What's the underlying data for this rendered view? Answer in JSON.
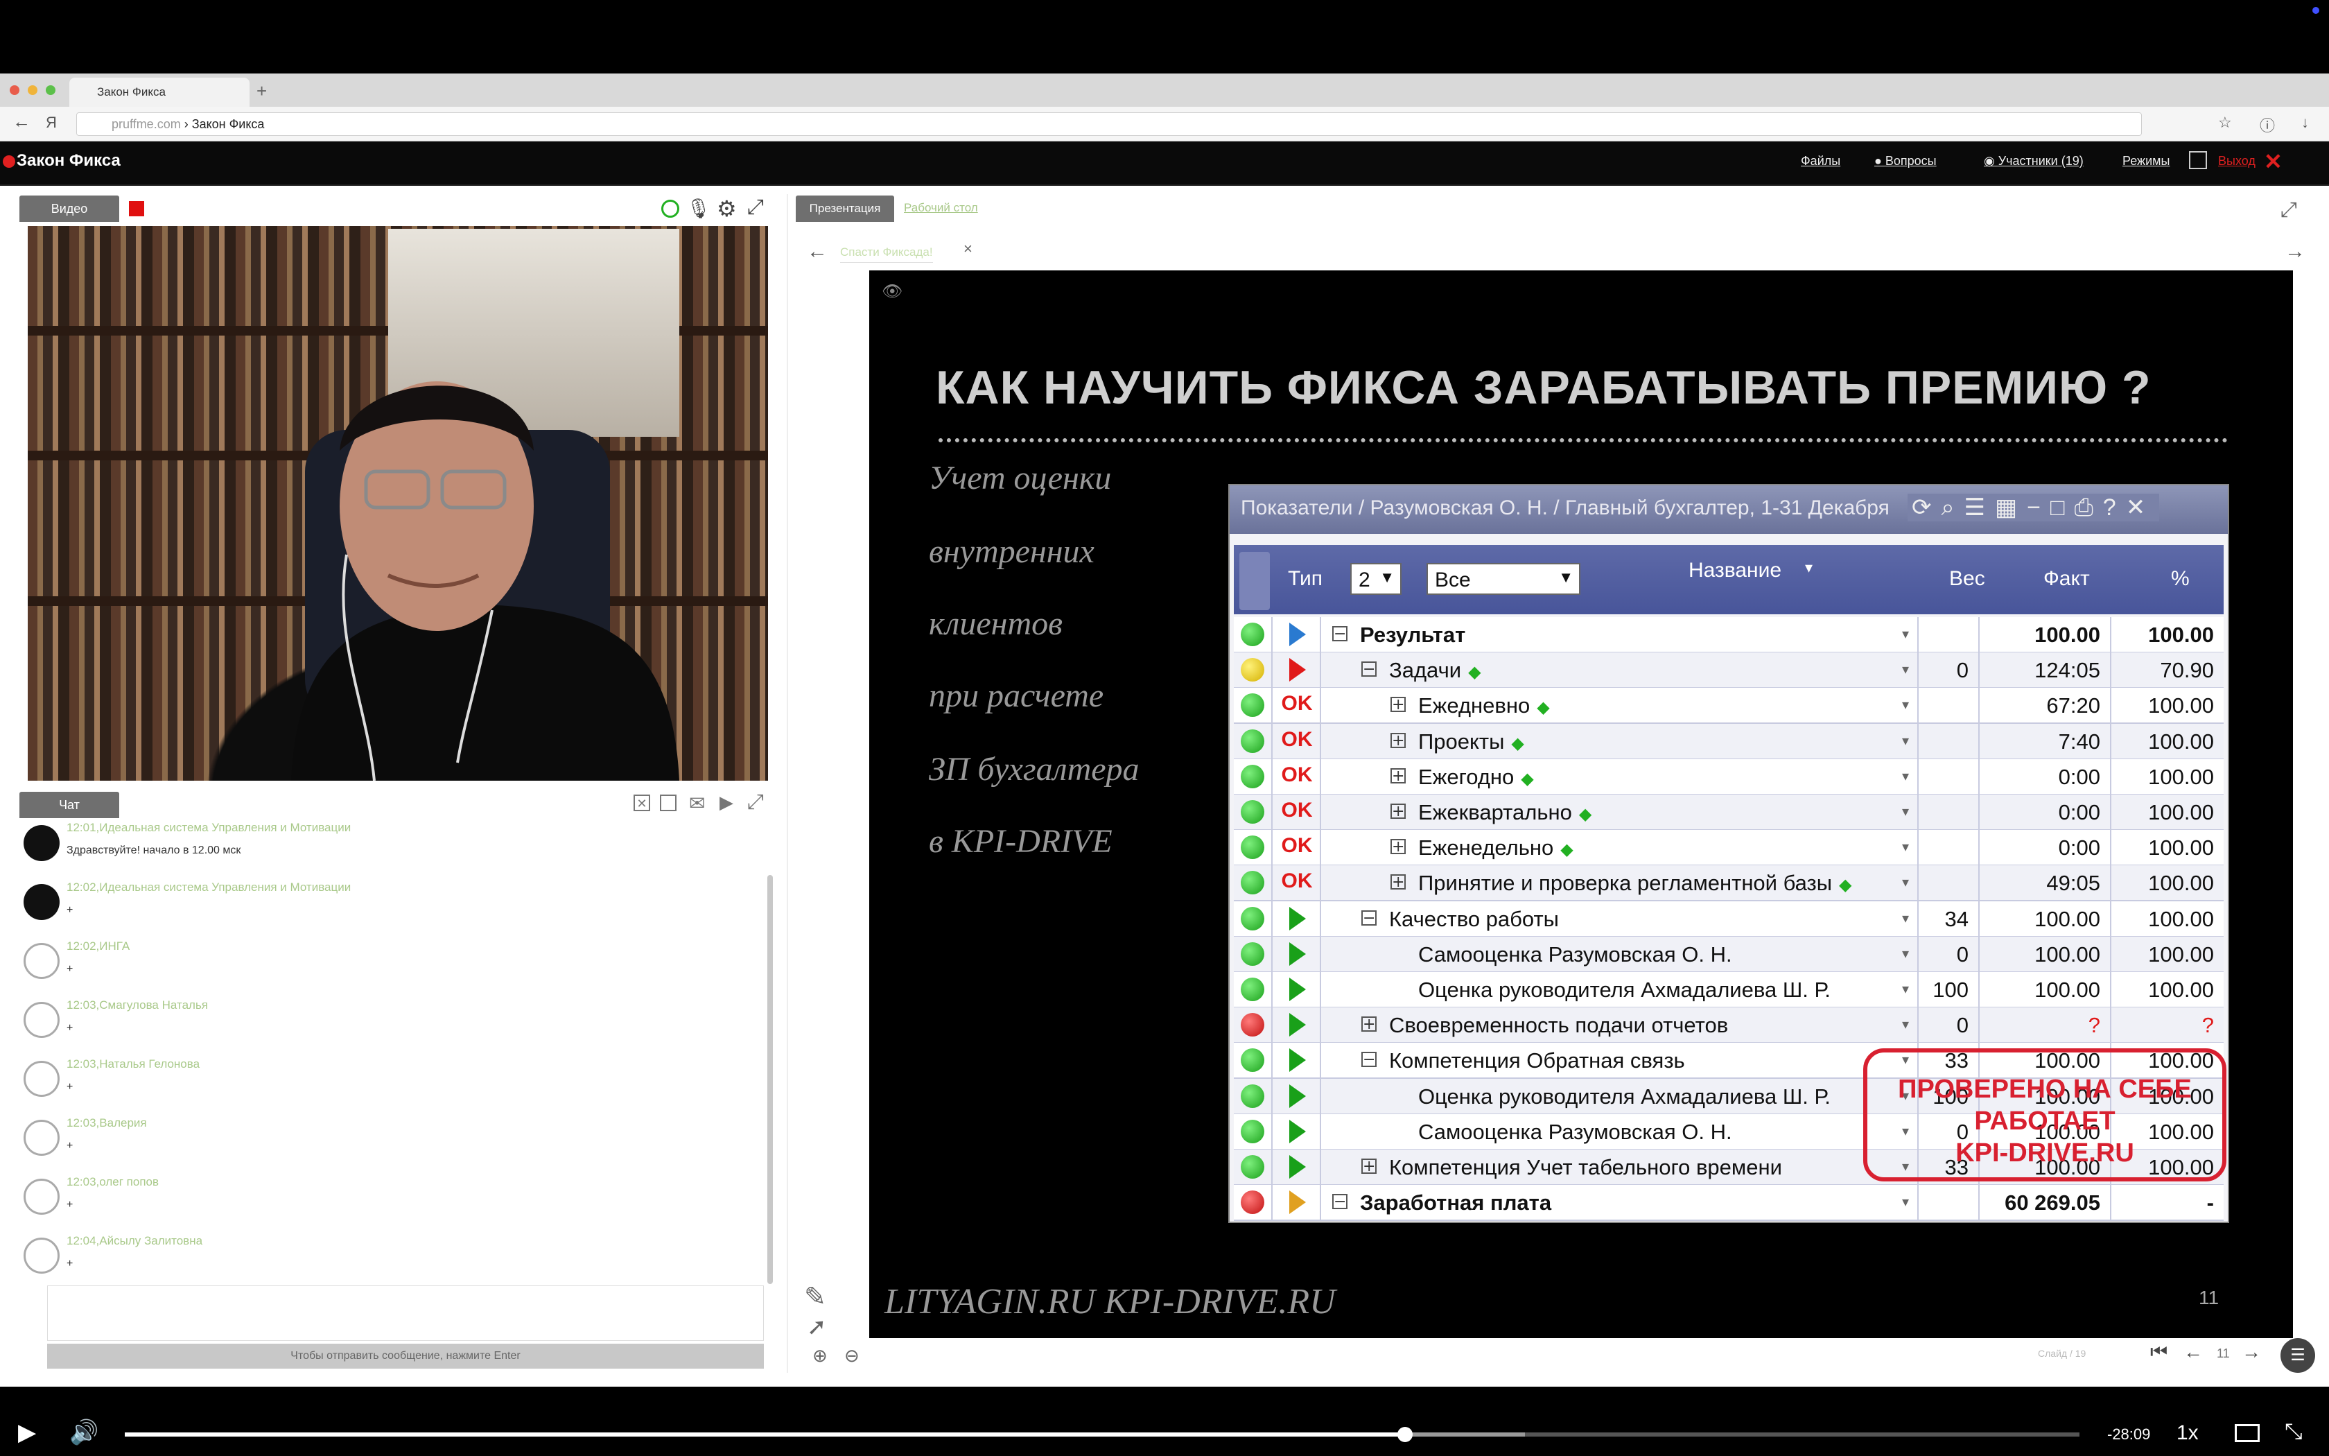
{
  "browser": {
    "tab_title": "Закон Фикса",
    "url_host": "pruffme.com",
    "url_sep": " › ",
    "url_path": "Закон Фикса"
  },
  "app": {
    "name": "Закон Фикса",
    "nav": {
      "files": "Файлы",
      "questions": "Вопросы",
      "participants": "Участники (19)",
      "modes": "Режимы",
      "exit": "Выход"
    }
  },
  "video_panel": {
    "tab": "Видео"
  },
  "chat": {
    "tab": "Чат",
    "messages": [
      {
        "time": "12:01",
        "author": "Идеальная система Управления и Мотивации",
        "text": "Здравствуйте! начало в 12.00 мск"
      },
      {
        "time": "12:02",
        "author": "Идеальная система Управления и Мотивации",
        "text": "+"
      },
      {
        "time": "12:02",
        "author": "ИНГА",
        "text": "+"
      },
      {
        "time": "12:03",
        "author": "Смагулова Наталья",
        "text": "+"
      },
      {
        "time": "12:03",
        "author": "Наталья Гелонова",
        "text": "+"
      },
      {
        "time": "12:03",
        "author": "Валерия",
        "text": "+"
      },
      {
        "time": "12:03",
        "author": "олег попов",
        "text": "+"
      },
      {
        "time": "12:04",
        "author": "Айсылу Залитовна",
        "text": "+"
      }
    ],
    "hint": "Чтобы отправить сообщение, нажмите Enter"
  },
  "presentation": {
    "tabs": [
      "Презентация",
      "Рабочий стол"
    ],
    "file_tab": "Спасти Фиксада!",
    "slide": {
      "title": "КАК НАУЧИТЬ ФИКСА ЗАРАБАТЫВАТЬ ПРЕМИЮ ?",
      "left_text": [
        "Учет оценки",
        "внутренних",
        "клиентов",
        "при расчете",
        "ЗП бухгалтера",
        "в KPI-DRIVE"
      ],
      "footer": "LITYAGIN.RU  KPI-DRIVE.RU",
      "number": "11",
      "stamp": [
        "ПРОВЕРЕНО НА СЕБЕ",
        "РАБОТАЕТ",
        "KPI-DRIVE.RU"
      ],
      "kpi_window": {
        "title": "Показатели / Разумовская О. Н. / Главный бухгалтер, 1-31 Декабря",
        "headers": {
          "type": "Тип",
          "level": "2",
          "filter": "Все",
          "name": "Название",
          "weight": "Вес",
          "fact": "Факт",
          "pct": "%"
        },
        "rows": [
          {
            "status": "g",
            "type": "flag-blue",
            "expand": "−",
            "indent": 0,
            "name": "Результат",
            "bold": true,
            "diamond": false,
            "weight": "",
            "fact": "100.00",
            "pct": "100.00"
          },
          {
            "status": "y",
            "type": "flag-red",
            "expand": "−",
            "indent": 1,
            "name": "Задачи",
            "bold": false,
            "diamond": true,
            "weight": "0",
            "fact": "124:05",
            "pct": "70.90"
          },
          {
            "status": "g",
            "type": "OK",
            "expand": "+",
            "indent": 2,
            "name": "Ежедневно",
            "bold": false,
            "diamond": true,
            "weight": "",
            "fact": "67:20",
            "pct": "100.00"
          },
          {
            "status": "g",
            "type": "OK",
            "expand": "+",
            "indent": 2,
            "name": "Проекты",
            "bold": false,
            "diamond": true,
            "weight": "",
            "fact": "7:40",
            "pct": "100.00"
          },
          {
            "status": "g",
            "type": "OK",
            "expand": "+",
            "indent": 2,
            "name": "Ежегодно",
            "bold": false,
            "diamond": true,
            "weight": "",
            "fact": "0:00",
            "pct": "100.00"
          },
          {
            "status": "g",
            "type": "OK",
            "expand": "+",
            "indent": 2,
            "name": "Ежеквартально",
            "bold": false,
            "diamond": true,
            "weight": "",
            "fact": "0:00",
            "pct": "100.00"
          },
          {
            "status": "g",
            "type": "OK",
            "expand": "+",
            "indent": 2,
            "name": "Еженедельно",
            "bold": false,
            "diamond": true,
            "weight": "",
            "fact": "0:00",
            "pct": "100.00"
          },
          {
            "status": "g",
            "type": "OK",
            "expand": "+",
            "indent": 2,
            "name": "Принятие и проверка регламентной базы",
            "bold": false,
            "diamond": true,
            "weight": "",
            "fact": "49:05",
            "pct": "100.00"
          },
          {
            "status": "g",
            "type": "flag-green",
            "expand": "−",
            "indent": 1,
            "name": "Качество работы",
            "bold": false,
            "diamond": false,
            "weight": "34",
            "fact": "100.00",
            "pct": "100.00"
          },
          {
            "status": "g",
            "type": "flag-green",
            "expand": "",
            "indent": 2,
            "name": "Самооценка Разумовская О. Н.",
            "bold": false,
            "diamond": false,
            "weight": "0",
            "fact": "100.00",
            "pct": "100.00"
          },
          {
            "status": "g",
            "type": "flag-green",
            "expand": "",
            "indent": 2,
            "name": "Оценка руководителя Ахмадалиева Ш. Р.",
            "bold": false,
            "diamond": false,
            "weight": "100",
            "fact": "100.00",
            "pct": "100.00"
          },
          {
            "status": "r",
            "type": "flag-green",
            "expand": "+",
            "indent": 1,
            "name": "Своевременность подачи отчетов",
            "bold": false,
            "diamond": false,
            "weight": "0",
            "fact": "?",
            "pct": "?"
          },
          {
            "status": "g",
            "type": "flag-green",
            "expand": "−",
            "indent": 1,
            "name": "Компетенция Обратная связь",
            "bold": false,
            "diamond": false,
            "weight": "33",
            "fact": "100.00",
            "pct": "100.00"
          },
          {
            "status": "g",
            "type": "flag-green",
            "expand": "",
            "indent": 2,
            "name": "Оценка руководителя Ахмадалиева Ш. Р.",
            "bold": false,
            "diamond": false,
            "weight": "100",
            "fact": "100.00",
            "pct": "100.00"
          },
          {
            "status": "g",
            "type": "flag-green",
            "expand": "",
            "indent": 2,
            "name": "Самооценка Разумовская О. Н.",
            "bold": false,
            "diamond": false,
            "weight": "0",
            "fact": "100.00",
            "pct": "100.00"
          },
          {
            "status": "g",
            "type": "flag-green",
            "expand": "+",
            "indent": 1,
            "name": "Компетенция Учет табельного времени",
            "bold": false,
            "diamond": false,
            "weight": "33",
            "fact": "100.00",
            "pct": "100.00"
          },
          {
            "status": "r",
            "type": "flag-org",
            "expand": "−",
            "indent": 0,
            "name": "Заработная плата",
            "bold": true,
            "diamond": false,
            "weight": "",
            "fact": "60 269.05",
            "pct": "-"
          }
        ]
      }
    },
    "pager": {
      "label": "Слайд / 19",
      "current": "11"
    }
  },
  "player": {
    "time": "-28:09",
    "speed": "1x",
    "progress_fraction": 0.655
  }
}
